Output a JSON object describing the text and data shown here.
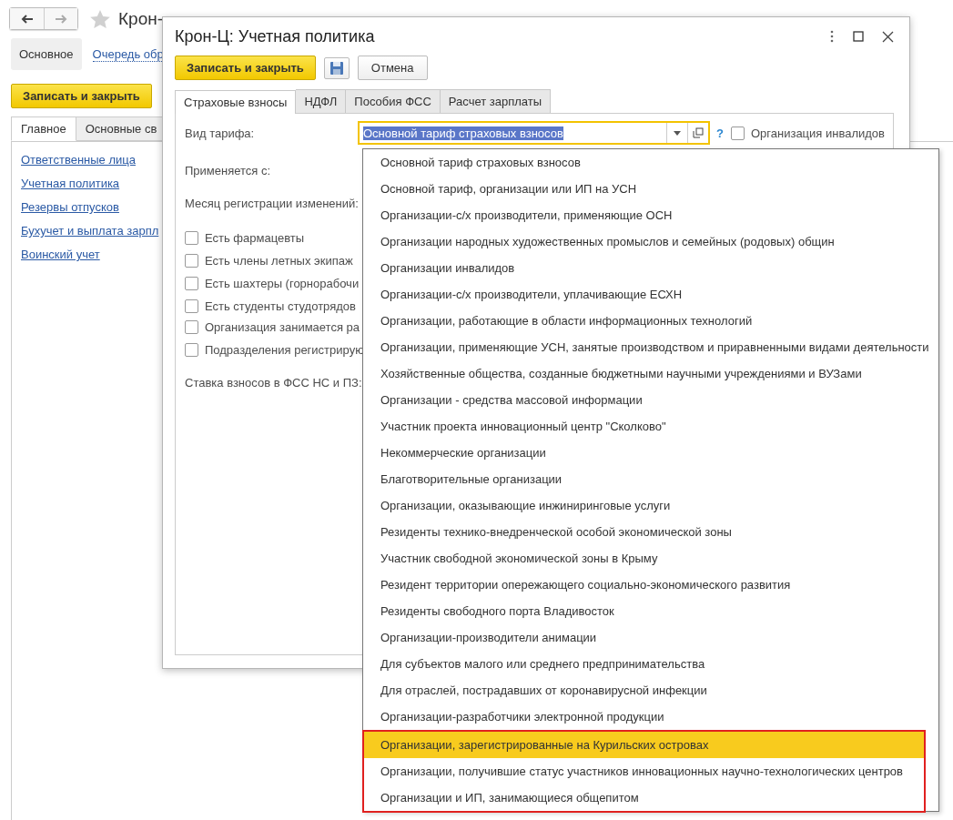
{
  "main_window": {
    "title": "Крон-",
    "sections": [
      {
        "label": "Основное",
        "selected": true
      },
      {
        "label": "Очередь обр",
        "selected": false
      }
    ],
    "primary_button": "Записать и закрыть",
    "tabs": [
      {
        "label": "Главное",
        "selected": true
      },
      {
        "label": "Основные св",
        "selected": false
      }
    ],
    "links": [
      "Ответственные лица",
      "Учетная политика",
      "Резервы отпусков",
      "Бухучет и выплата зарпл",
      "Воинский учет"
    ]
  },
  "dialog": {
    "title": "Крон-Ц: Учетная политика",
    "primary_button": "Записать и закрыть",
    "cancel_button": "Отмена",
    "tabs": [
      {
        "label": "Страховые взносы",
        "selected": true
      },
      {
        "label": "НДФЛ",
        "selected": false
      },
      {
        "label": "Пособия ФСС",
        "selected": false
      },
      {
        "label": "Расчет зарплаты",
        "selected": false
      }
    ],
    "tariff": {
      "label": "Вид тарифа:",
      "value": "Основной тариф страховых взносов",
      "focused": true,
      "value_selected": true,
      "help": "?",
      "disabled_org": {
        "label": "Организация инвалидов",
        "checked": false
      }
    },
    "labels": [
      "Применяется с:",
      "Месяц регистрации изменений:"
    ],
    "checkbox_groups": [
      [
        {
          "label": "Есть фармацевты",
          "checked": false
        },
        {
          "label": "Есть члены летных экипаж",
          "checked": false
        },
        {
          "label": "Есть шахтеры (горнорабочи",
          "checked": false
        },
        {
          "label": "Есть студенты студотрядов",
          "checked": false
        }
      ],
      [
        {
          "label": "Организация занимается ра",
          "checked": false
        },
        {
          "label": "Подразделения регистрирую",
          "checked": false
        }
      ]
    ],
    "rate_label": "Ставка взносов в ФСС НС и ПЗ:"
  },
  "dropdown": {
    "items": [
      {
        "label": "Основной тариф страховых взносов",
        "selected": false,
        "framed": false
      },
      {
        "label": "Основной тариф, организации или ИП на УСН",
        "selected": false,
        "framed": false
      },
      {
        "label": "Организации-с/х производители, применяющие ОСН",
        "selected": false,
        "framed": false
      },
      {
        "label": "Организации народных художественных промыслов и семейных (родовых) общин",
        "selected": false,
        "framed": false
      },
      {
        "label": "Организации инвалидов",
        "selected": false,
        "framed": false
      },
      {
        "label": "Организации-с/х производители, уплачивающие ЕСХН",
        "selected": false,
        "framed": false
      },
      {
        "label": "Организации, работающие в области информационных технологий",
        "selected": false,
        "framed": false
      },
      {
        "label": "Организации, применяющие УСН, занятые производством и приравненными видами деятельности",
        "selected": false,
        "framed": false
      },
      {
        "label": "Хозяйственные общества, созданные бюджетными научными учреждениями и ВУЗами",
        "selected": false,
        "framed": false
      },
      {
        "label": "Организации - средства массовой информации",
        "selected": false,
        "framed": false
      },
      {
        "label": "Участник проекта инновационный центр \"Сколково\"",
        "selected": false,
        "framed": false
      },
      {
        "label": "Некоммерческие организации",
        "selected": false,
        "framed": false
      },
      {
        "label": "Благотворительные организации",
        "selected": false,
        "framed": false
      },
      {
        "label": "Организации, оказывающие инжиниринговые услуги",
        "selected": false,
        "framed": false
      },
      {
        "label": "Резиденты технико-внедренческой особой экономической зоны",
        "selected": false,
        "framed": false
      },
      {
        "label": "Участник свободной экономической зоны в Крыму",
        "selected": false,
        "framed": false
      },
      {
        "label": "Резидент территории опережающего социально-экономического развития",
        "selected": false,
        "framed": false
      },
      {
        "label": "Резиденты свободного порта Владивосток",
        "selected": false,
        "framed": false
      },
      {
        "label": "Организации-производители анимации",
        "selected": false,
        "framed": false
      },
      {
        "label": "Для субъектов малого или среднего предпринимательства",
        "selected": false,
        "framed": false
      },
      {
        "label": "Для отраслей, пострадавших от коронавирусной инфекции",
        "selected": false,
        "framed": false
      },
      {
        "label": "Организации-разработчики электронной продукции",
        "selected": false,
        "framed": false
      },
      {
        "label": "Организации, зарегистрированные на Курильских островах",
        "selected": true,
        "framed": true
      },
      {
        "label": "Организации, получившие статус участников инновационных научно-технологических центров",
        "selected": false,
        "framed": true
      },
      {
        "label": "Организации и ИП, занимающиеся общепитом",
        "selected": false,
        "framed": true
      }
    ]
  }
}
